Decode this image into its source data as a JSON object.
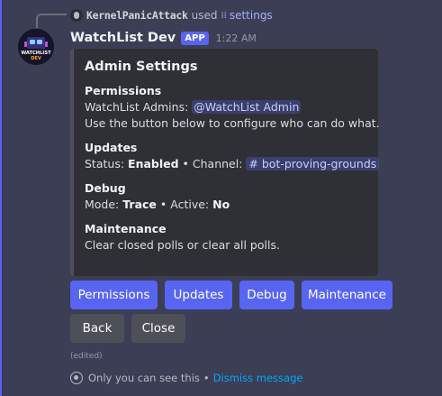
{
  "reply": {
    "user": "KernelPanicAttack",
    "used_text": "used",
    "command": "settings"
  },
  "message": {
    "bot_name": "WatchList Dev",
    "badge": "APP",
    "timestamp": "1:22 AM",
    "avatar_text": "WATCHLIST",
    "avatar_subtext": "DEV"
  },
  "embed": {
    "title": "Admin Settings",
    "fields": [
      {
        "name": "Permissions",
        "admins_label": "WatchList Admins:",
        "admins_mention": "@WatchList Admin",
        "line2": "Use the button below to configure who can do what."
      },
      {
        "name": "Updates",
        "status_label": "Status:",
        "status_value": "Enabled",
        "channel_label": "• Channel:",
        "channel_value": "# bot-proving-grounds"
      },
      {
        "name": "Debug",
        "mode_label": "Mode:",
        "mode_value": "Trace",
        "active_label": "• Active:",
        "active_value": "No"
      },
      {
        "name": "Maintenance",
        "value": "Clear closed polls or clear all polls."
      }
    ]
  },
  "buttons": {
    "row1": [
      "Permissions",
      "Updates",
      "Debug",
      "Maintenance"
    ],
    "row2": [
      "Back",
      "Close"
    ]
  },
  "footer": {
    "edited": "(edited)",
    "ephemeral": "Only you can see this",
    "separator": "•",
    "dismiss": "Dismiss message"
  },
  "colors": {
    "accent": "#5865f2",
    "background": "#3c3e55",
    "embed_bg": "#2e3036",
    "secondary_button": "#4e5058",
    "link": "#00a8fc"
  }
}
